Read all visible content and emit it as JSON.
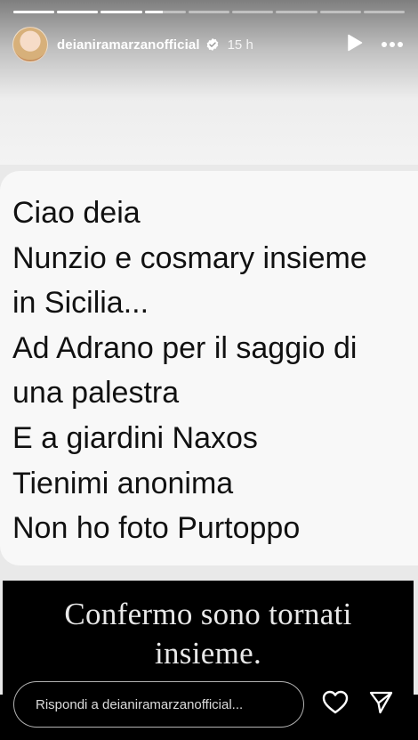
{
  "story": {
    "segment_count": 9,
    "active_segment": 4,
    "active_progress": 0.45,
    "user": {
      "username": "deianiramarzanofficial",
      "verified": true,
      "time": "15 h",
      "avatar_icon": "profile-avatar"
    },
    "message_lines": [
      "Ciao deia",
      "Nunzio e cosmary insieme",
      "in Sicilia...",
      "Ad Adrano per il saggio di",
      "una  palestra",
      "E a giardini Naxos",
      "Tienimi anonima",
      "Non ho foto Purtoppo"
    ],
    "caption_lines": [
      "Confermo sono tornati",
      "insieme."
    ],
    "reply_placeholder": "Rispondi a deianiramarzanofficial...",
    "icons": {
      "play": "play-icon",
      "more": "more-icon",
      "like": "heart-icon",
      "share": "send-icon",
      "verified": "verified-badge-icon"
    },
    "colors": {
      "bubble": "#f8f8f8",
      "background": "#e9e9e9",
      "message_text": "#111111",
      "caption_background": "#000000",
      "caption_text": "#e8e8e8"
    }
  }
}
